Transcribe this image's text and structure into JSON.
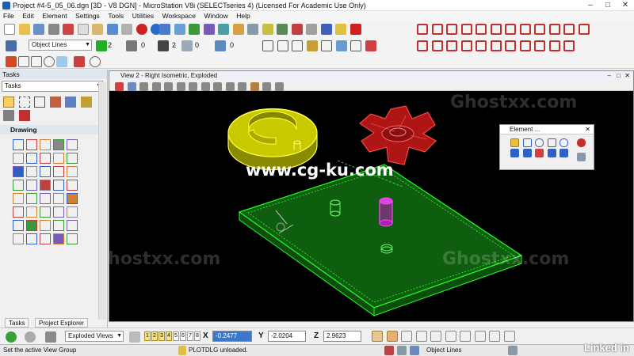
{
  "window": {
    "title": "Project #4-5_05_06.dgn [3D - V8 DGN] - MicroStation V8i (SELECTseries 4) (Licensed For Academic Use Only)"
  },
  "menu": [
    "File",
    "Edit",
    "Element",
    "Settings",
    "Tools",
    "Utilities",
    "Workspace",
    "Window",
    "Help"
  ],
  "toolbar": {
    "level_combo": "Object Lines",
    "color_value": "2",
    "style_value": "0",
    "weight_value": "2",
    "transparency_value": "0",
    "priority_value": "0"
  },
  "tasks": {
    "header": "Tasks",
    "combo": "Tasks",
    "drawing_header": "Drawing"
  },
  "view": {
    "title": "View 2 - Right Isometric, Exploded",
    "overlay_url": "www.cg-ku.com",
    "watermark": "Ghostxx.com"
  },
  "element_dialog": {
    "title": "Element ..."
  },
  "tabs": [
    "Tasks",
    "Project Explorer"
  ],
  "statusrow": {
    "view_group": "Exploded Views",
    "view_numbers": [
      "1",
      "2",
      "3",
      "4",
      "5",
      "6",
      "7",
      "8"
    ],
    "x_label": "X",
    "x_value": "-0.2477",
    "y_label": "Y",
    "y_value": "-2.0204",
    "z_label": "Z",
    "z_value": "2.9623"
  },
  "bottom": {
    "prompt": "Set the active View Group",
    "message": "PLOTDLG unloaded.",
    "level": "Object Lines",
    "brand": "Linked in"
  },
  "colors": {
    "yellow_part": "#e8e800",
    "red_part": "#ff1a1a",
    "green_plate": "#22d022",
    "magenta_pin": "#ff22ff",
    "canvas_bg": "#000000"
  }
}
